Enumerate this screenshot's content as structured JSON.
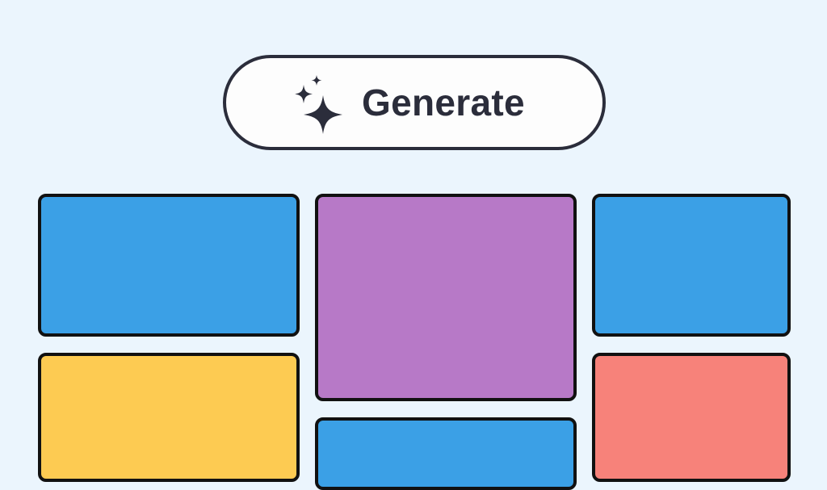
{
  "generate_button": {
    "label": "Generate",
    "icon": "sparkles-icon"
  },
  "tiles": [
    {
      "name": "tile-top-left",
      "color": "#3ba0e6"
    },
    {
      "name": "tile-bottom-left",
      "color": "#fdcb52"
    },
    {
      "name": "tile-top-center",
      "color": "#b779c7"
    },
    {
      "name": "tile-bottom-center",
      "color": "#3ba0e6"
    },
    {
      "name": "tile-top-right",
      "color": "#3ba0e6"
    },
    {
      "name": "tile-bottom-right",
      "color": "#f7827a"
    }
  ]
}
